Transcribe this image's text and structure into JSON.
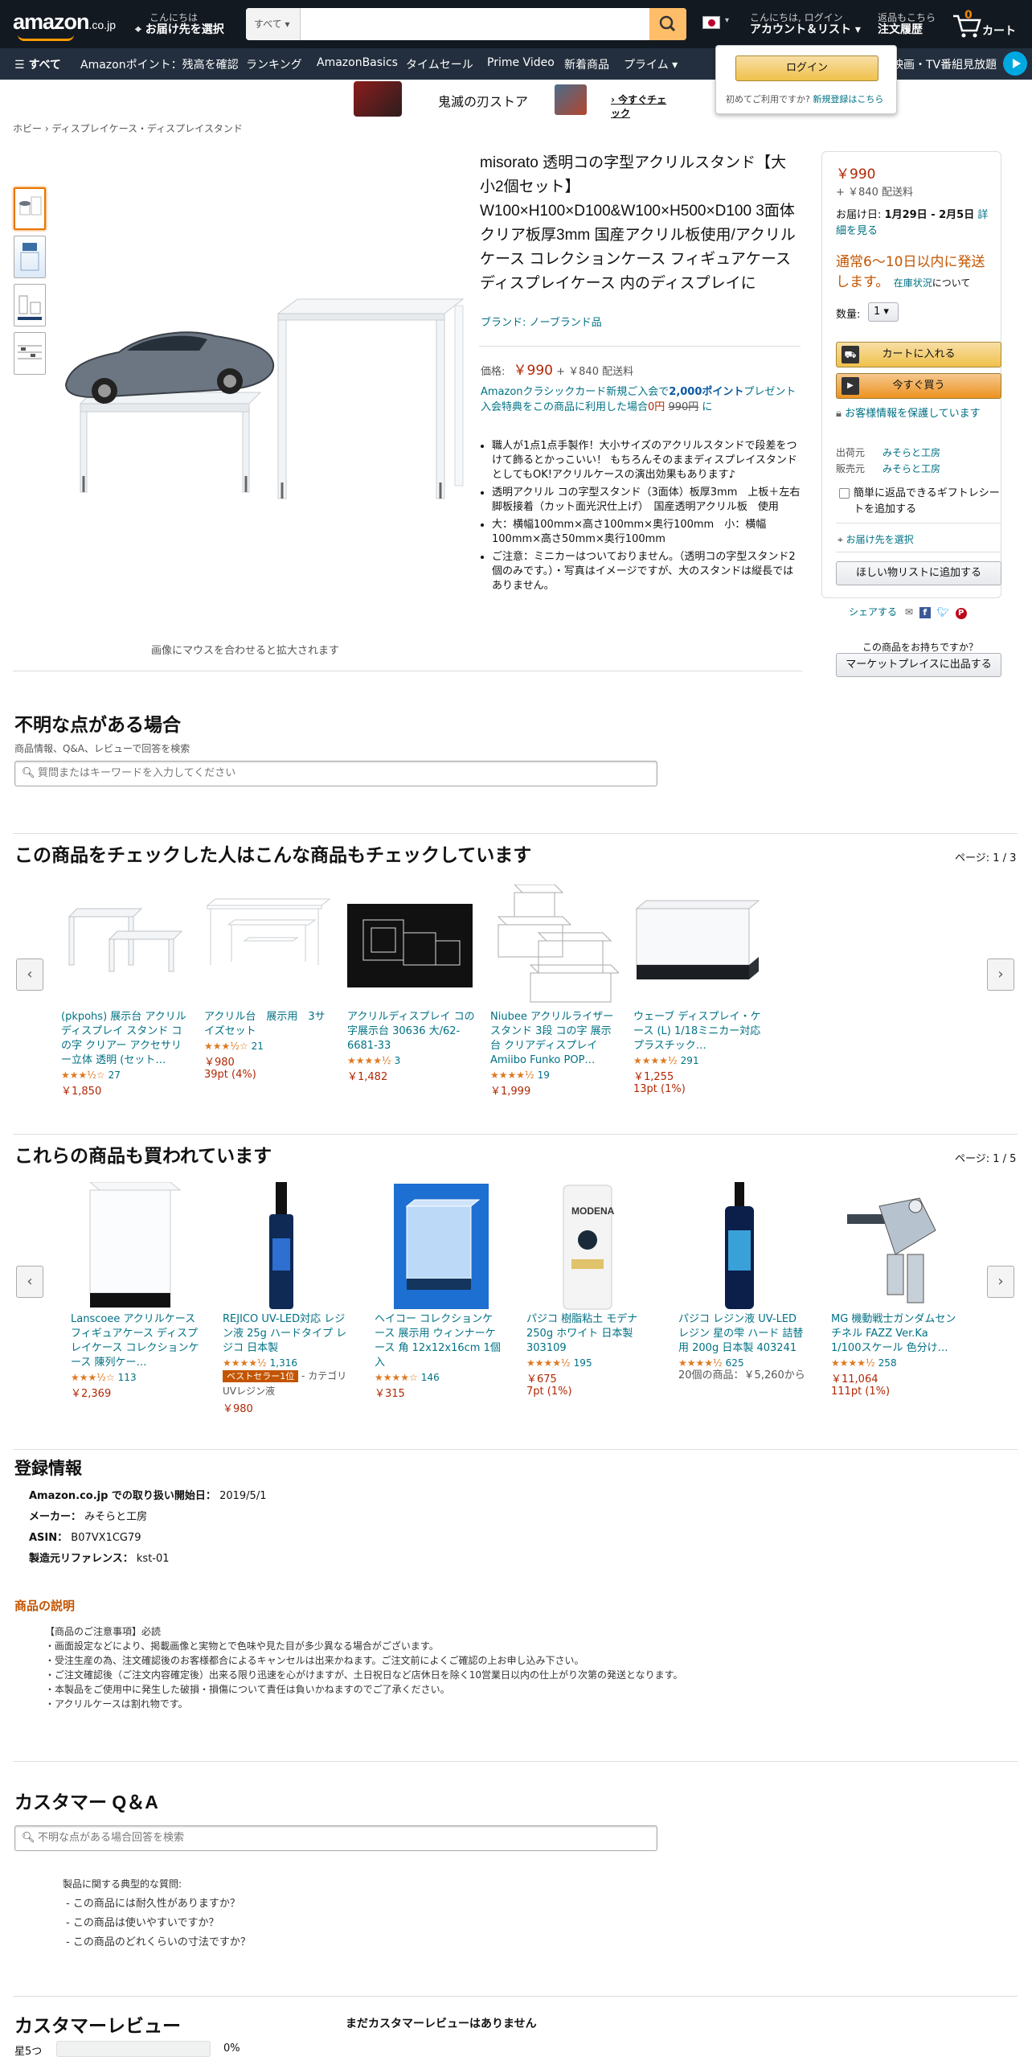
{
  "header": {
    "logo": "amazon",
    "logo_tld": ".co.jp",
    "deliver_l1": "こんにちは",
    "deliver_l2": "お届け先を選択",
    "search_category": "すべて",
    "account_l1": "こんにちは, ログイン",
    "account_l2": "アカウント＆リスト",
    "orders_l1": "返品もこちら",
    "orders_l2": "注文履歴",
    "cart_count": "0",
    "cart_label": "カート"
  },
  "subnav": {
    "all": "すべて",
    "items": [
      "Amazonポイント：残高を確認",
      "ランキング",
      "AmazonBasics",
      "タイムセール",
      "Prime Video",
      "新着商品",
      "プライム"
    ],
    "right": "映画・TV番組見放題"
  },
  "signin_popup": {
    "button": "ログイン",
    "new_text": "初めてご利用ですか?",
    "new_link": "新規登録はこちら"
  },
  "banner": {
    "title": "鬼滅の刃ストア",
    "link": "今すぐチェック"
  },
  "breadcrumb": [
    "ホビー",
    "ディスプレイケース・ディスプレイスタンド"
  ],
  "product": {
    "title": "misorato 透明コの字型アクリルスタンド【大小2個セット】W100×H100×D100&W100×H500×D100 3面体クリア板厚3mm 国産アクリル板使用/アクリルケース コレクションケース フィギュアケース ディスプレイケース 内のディスプレイに",
    "brand": "ブランド: ノーブランド品",
    "price_label": "価格:",
    "price": "￥990",
    "shipping": "+ ￥840 配送料",
    "promo_text": "Amazonクラシックカード新規ご入会で",
    "promo_points": "2,000ポイント",
    "promo_suffix": "プレゼント",
    "promo_line2a": "入会特典をこの商品に利用した場合",
    "promo_line2b": "0円",
    "promo_line2c": "990円",
    "promo_line2d": "に",
    "bullets": [
      "職人が1点1点手製作！大小サイズのアクリルスタンドで段差をつけて飾るとかっこいい！ もちろんそのままディスプレイスタンドとしてもOK!アクリルケースの演出効果もあります♪",
      "透明アクリル コの字型スタンド（3面体）板厚3mm　上板＋左右脚板接着（カット面光沢仕上げ）　国産透明アクリル板　使用",
      "大：横幅100mm×高さ100mm×奥行100mm　小：横幅100mm×高さ50mm×奥行100mm",
      "ご注意：ミニカーはついておりません。（透明コの字型スタンド2個のみです。）・写真はイメージですが、大のスタンドは縦長ではありません。"
    ],
    "zoom_hint": "画像にマウスを合わせると拡大されます"
  },
  "buybox": {
    "price": "￥990",
    "shipping": "+ ￥840 配送料",
    "delivery_prefix": "お届け日:",
    "delivery_dates": "1月29日 - 2月5日",
    "delivery_link": "詳細を見る",
    "availability": "通常6～10日以内に発送します。",
    "stock_link": "在庫状況",
    "stock_suffix": "について",
    "qty_label": "数量:",
    "qty_value": "1",
    "add_to_cart": "カートに入れる",
    "buy_now": "今すぐ買う",
    "secure": "お客様情報を保護しています",
    "ships_from_label": "出荷元",
    "ships_from": "みそらと工房",
    "sold_by_label": "販売元",
    "sold_by": "みそらと工房",
    "gift_label": "簡単に返品できるギフトレシートを追加する",
    "address_link": "お届け先を選択",
    "wishlist": "ほしい物リストに追加する",
    "share": "シェアする",
    "sell_q": "この商品をお持ちですか？",
    "sell_btn": "マーケットプレイスに出品する"
  },
  "qa_top": {
    "title": "不明な点がある場合",
    "subtitle": "商品情報、Q&A、レビューで回答を検索",
    "placeholder": "質問またはキーワードを入力してください"
  },
  "carousel1": {
    "title": "この商品をチェックした人はこんな商品もチェックしています",
    "page": "ページ: 1 / 3",
    "items": [
      {
        "title": "(pkpohs) 展示台 アクリル ディスプレイ スタンド コの字 クリアー アクセサリー立体 透明 (セット…",
        "stars": "★★★½☆",
        "count": "27",
        "price": "￥1,850",
        "points": ""
      },
      {
        "title": "アクリル台　展示用　3サイズセット",
        "stars": "★★★½☆",
        "count": "21",
        "price": "￥980",
        "points": "39pt (4%)"
      },
      {
        "title": "アクリルディスプレイ コの字展示台 30636 大/62-6681-33",
        "stars": "★★★★½",
        "count": "3",
        "price": "￥1,482",
        "points": ""
      },
      {
        "title": "Niubee アクリルライザースタンド 3段 コの字 展示台 クリアディスプレイ Amiibo Funko POP…",
        "stars": "★★★★½",
        "count": "19",
        "price": "￥1,999",
        "points": ""
      },
      {
        "title": "ウェーブ ディスプレイ・ケース (L) 1/18ミニカー対応 プラスチック…",
        "stars": "★★★★½",
        "count": "291",
        "price": "￥1,255",
        "points": "13pt (1%)"
      }
    ]
  },
  "carousel2": {
    "title": "これらの商品も買われています",
    "page": "ページ: 1 / 5",
    "items": [
      {
        "title": "Lanscoee アクリルケース フィギュアケース ディスプレイケース コレクションケース 陳列ケー…",
        "stars": "★★★½☆",
        "count": "113",
        "price": "￥2,369",
        "points": "",
        "extra": "",
        "badge": "",
        "badge_cat": ""
      },
      {
        "title": "REJICO UV-LED対応 レジン液 25g ハードタイプ レジコ 日本製",
        "stars": "★★★★½",
        "count": "1,316",
        "price": "￥980",
        "points": "",
        "extra": "",
        "badge": "ベストセラー1位",
        "badge_cat": "- カテゴリ UVレジン液"
      },
      {
        "title": "ヘイコー コレクションケース 展示用 ウィンナーケース 角 12x12x16cm 1個入",
        "stars": "★★★★☆",
        "count": "146",
        "price": "￥315",
        "points": "",
        "extra": "",
        "badge": "",
        "badge_cat": ""
      },
      {
        "title": "パジコ 樹脂粘土 モデナ 250g ホワイト 日本製 303109",
        "stars": "★★★★½",
        "count": "195",
        "price": "￥675",
        "points": "7pt (1%)",
        "extra": "",
        "badge": "",
        "badge_cat": ""
      },
      {
        "title": "パジコ レジン液 UV-LEDレジン 星の雫 ハード 詰替用 200g 日本製 403241",
        "stars": "★★★★½",
        "count": "625",
        "price": "",
        "points": "",
        "extra": "20個の商品：￥5,260から",
        "badge": "",
        "badge_cat": ""
      },
      {
        "title": "MG 機動戦士ガンダムセンチネル FAZZ Ver.Ka 1/100スケール 色分け…",
        "stars": "★★★★½",
        "count": "258",
        "price": "￥11,064",
        "points": "111pt (1%)",
        "extra": "",
        "badge": "",
        "badge_cat": ""
      }
    ]
  },
  "registration": {
    "title": "登録情報",
    "rows": [
      {
        "k": "Amazon.co.jp での取り扱い開始日：",
        "v": "2019/5/1"
      },
      {
        "k": "メーカー：",
        "v": "みそらと工房"
      },
      {
        "k": "ASIN：",
        "v": "B07VX1CG79"
      },
      {
        "k": "製造元リファレンス：",
        "v": "kst-01"
      }
    ]
  },
  "description": {
    "title": "商品の説明",
    "lines": [
      "【商品のご注意事項】必読",
      "・画面設定などにより、掲載画像と実物とで色味や見た目が多少異なる場合がございます。",
      "・受注生産の為、注文確認後のお客様都合によるキャンセルは出来かねます。ご注文前によくご確認の上お申し込み下さい。",
      "・ご注文確認後（ご注文内容確定後）出来る限り迅速を心がけますが、土日祝日など店休日を除く10営業日以内の仕上がり次第の発送となります。",
      "・本製品をご使用中に発生した破損・損傷について責任は負いかねますのでご了承ください。",
      "・アクリルケースは割れ物です。"
    ]
  },
  "customer_qa": {
    "title": "カスタマー Q＆A",
    "placeholder": "不明な点がある場合回答を検索",
    "typical": "製品に関する典型的な質問:",
    "questions": [
      "この商品には耐久性がありますか？",
      "この商品は使いやすいですか？",
      "この商品のどれくらいの寸法ですか？"
    ]
  },
  "reviews": {
    "title": "カスタマーレビュー",
    "none": "まだカスタマーレビューはありません",
    "star5_label": "星5つ",
    "star5_pct": "0%"
  },
  "colors": {
    "header": "#131921",
    "subnav": "#232f3e",
    "accent": "#febd69",
    "link": "#007185",
    "price": "#b12704",
    "star": "#de7921"
  }
}
